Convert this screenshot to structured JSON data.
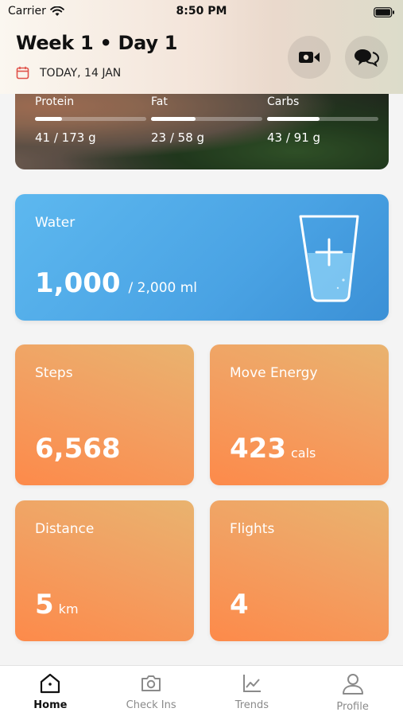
{
  "status_bar": {
    "carrier": "Carrier",
    "time": "8:50 PM"
  },
  "header": {
    "title": "Week 1 • Day 1",
    "date": "TODAY, 14 JAN"
  },
  "macros": [
    {
      "label": "Protein",
      "value": "41 / 173 g",
      "progress": 0.24
    },
    {
      "label": "Fat",
      "value": "23 / 58 g",
      "progress": 0.4
    },
    {
      "label": "Carbs",
      "value": "43 / 91 g",
      "progress": 0.47
    }
  ],
  "water": {
    "label": "Water",
    "amount": "1,000",
    "goal": "/  2,000 ml"
  },
  "stats": {
    "steps": {
      "label": "Steps",
      "value": "6,568",
      "unit": ""
    },
    "move": {
      "label": "Move Energy",
      "value": "423",
      "unit": "cals"
    },
    "distance": {
      "label": "Distance",
      "value": "5",
      "unit": "km"
    },
    "flights": {
      "label": "Flights",
      "value": "4",
      "unit": ""
    }
  },
  "tabs": [
    {
      "label": "Home",
      "icon": "home-icon",
      "active": true
    },
    {
      "label": "Check Ins",
      "icon": "camera-icon",
      "active": false
    },
    {
      "label": "Trends",
      "icon": "chart-icon",
      "active": false
    },
    {
      "label": "Profile",
      "icon": "person-icon",
      "active": false
    }
  ],
  "colors": {
    "water": "#4aa3e4",
    "activity": "#f29a5a",
    "accent": "#e0524a"
  }
}
